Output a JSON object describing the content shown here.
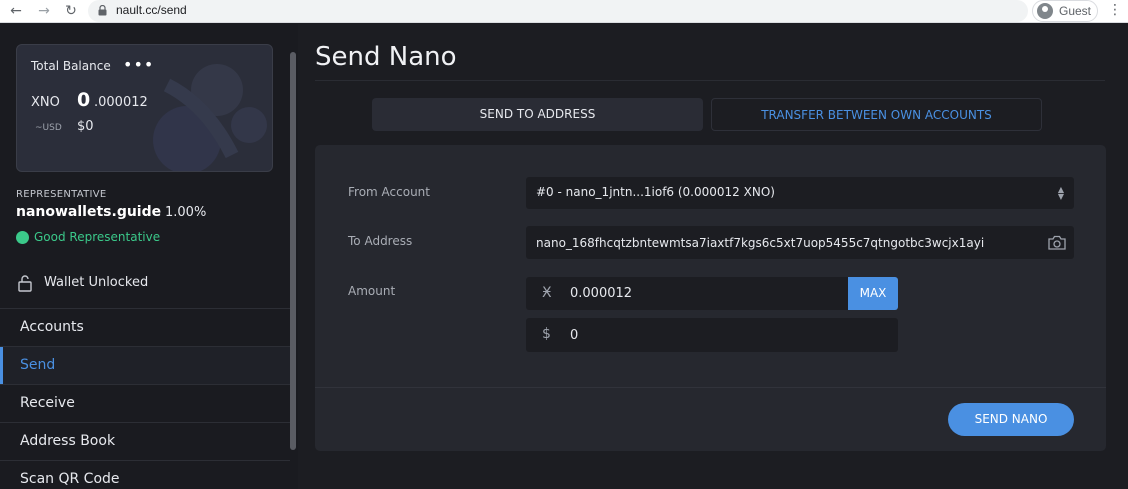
{
  "browser": {
    "url": "nault.cc/send",
    "profile_label": "Guest"
  },
  "sidebar": {
    "balance": {
      "title": "Total Balance",
      "more_glyph": "•••",
      "currency": "XNO",
      "amount_whole": "0",
      "amount_fraction": ".000012",
      "fiat_label": "~USD",
      "fiat_value": "$0"
    },
    "representative": {
      "label": "REPRESENTATIVE",
      "name": "nanowallets.guide",
      "weight": "1.00%",
      "status": "Good Representative",
      "status_color": "#3bc98a"
    },
    "wallet_status": "Wallet Unlocked",
    "nav": [
      {
        "label": "Accounts",
        "active": false
      },
      {
        "label": "Send",
        "active": true
      },
      {
        "label": "Receive",
        "active": false
      },
      {
        "label": "Address Book",
        "active": false
      },
      {
        "label": "Scan QR Code",
        "active": false
      }
    ]
  },
  "main": {
    "title": "Send Nano",
    "tabs": [
      {
        "label": "SEND TO ADDRESS",
        "active": true
      },
      {
        "label": "TRANSFER BETWEEN OWN ACCOUNTS",
        "active": false
      }
    ],
    "form": {
      "from_label": "From Account",
      "from_value": "#0 - nano_1jntn...1iof6 (0.000012 XNO)",
      "to_label": "To Address",
      "to_value": "nano_168fhcqtzbntewmtsa7iaxtf7kgs6c5xt7uop5455c7qtngotbc3wcjx1ayi",
      "amount_label": "Amount",
      "amount_symbol": "Ӿ",
      "amount_value": "0.000012",
      "max_label": "MAX",
      "fiat_symbol": "$",
      "fiat_value": "0",
      "submit_label": "SEND NANO"
    }
  },
  "colors": {
    "accent": "#4a90e2",
    "background": "#1c1d22",
    "panel": "#26282f"
  }
}
